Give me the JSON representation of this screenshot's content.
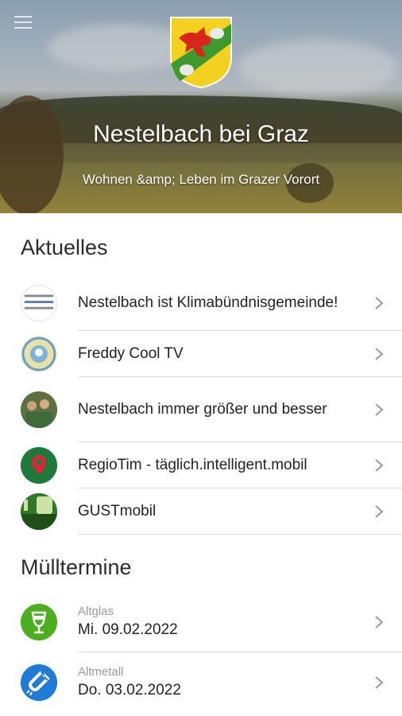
{
  "header": {
    "title": "Nestelbach bei Graz",
    "subtitle": "Wohnen &amp; Leben im Grazer Vorort"
  },
  "news": {
    "title": "Aktuelles",
    "items": [
      {
        "label": "Nestelbach ist Klimabündnisgemeinde!",
        "icon": "klimabuendnis-logo"
      },
      {
        "label": "Freddy Cool TV",
        "icon": "freddy-cool-badge"
      },
      {
        "label": "Nestelbach immer größer und besser",
        "icon": "community-photo"
      },
      {
        "label": "RegioTim - täglich.intelligent.mobil",
        "icon": "regiotim-logo"
      },
      {
        "label": "GUSTmobil",
        "icon": "gustmobil-logo"
      }
    ]
  },
  "waste": {
    "title": "Mülltermine",
    "items": [
      {
        "type": "Altglas",
        "date": "Mi. 09.02.2022",
        "icon": "glass-icon",
        "color": "#4caf1f"
      },
      {
        "type": "Altmetall",
        "date": "Do. 03.02.2022",
        "icon": "magnet-icon",
        "color": "#1e7bd6"
      }
    ]
  }
}
